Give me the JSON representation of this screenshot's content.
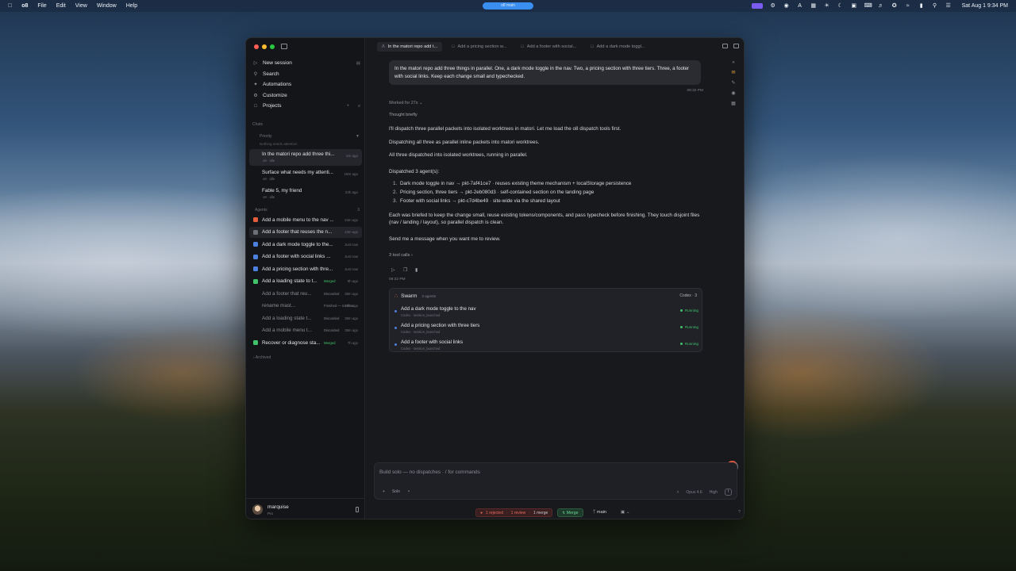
{
  "menubar": {
    "app_name": "o8",
    "menus": [
      "File",
      "Edit",
      "View",
      "Window",
      "Help"
    ],
    "center_pill": "o8 main",
    "clock": "Sat Aug 1  9:34 PM"
  },
  "sidebar": {
    "nav": [
      {
        "label": "New session",
        "icon": "play-icon"
      },
      {
        "label": "Search",
        "icon": "search-icon"
      },
      {
        "label": "Automations",
        "icon": "spark-icon"
      },
      {
        "label": "Customize",
        "icon": "gear-icon"
      },
      {
        "label": "Projects",
        "icon": "folder-icon"
      }
    ],
    "chats_label": "Chats",
    "priority_label": "Priority",
    "priority_sub": "Nothing needs attention",
    "chats": [
      {
        "title": "In the matori repo add three thi...",
        "sub": "o8 · idle",
        "time": "2m ago"
      },
      {
        "title": "Surface what needs my attenti...",
        "sub": "o8 · idle",
        "time": "18m ago"
      },
      {
        "title": "Fable 5, my friend",
        "sub": "o8 · idle",
        "time": "23h ago"
      }
    ],
    "agents_label": "Agents",
    "agents_count": "3",
    "agents": [
      {
        "title": "Add a mobile menu to the nav ...",
        "status": "",
        "time": "24m ago",
        "color": "#e35d3c"
      },
      {
        "title": "Add a footer that reuses the n...",
        "status": "",
        "time": "24m ago",
        "color": "#6d7078"
      },
      {
        "title": "Add a dark mode toggle to the...",
        "status": "",
        "time": "Just now",
        "color": "#4b7fe0"
      },
      {
        "title": "Add a footer with social links ...",
        "status": "",
        "time": "Just now",
        "color": "#4b7fe0"
      },
      {
        "title": "Add a pricing section with thre...",
        "status": "",
        "time": "Just now",
        "color": "#4b7fe0"
      },
      {
        "title": "Add a loading state to t...",
        "status": "Merged",
        "time": "9h ago",
        "color": "#3fc46b"
      },
      {
        "title": "Add a footer that reu...",
        "status": "Discarded",
        "time": "38m ago",
        "color": ""
      },
      {
        "title": "rename mast...",
        "status": "Finished — no char...",
        "time": "38m ago",
        "color": ""
      },
      {
        "title": "Add a loading state t...",
        "status": "Discarded",
        "time": "38m ago",
        "color": ""
      },
      {
        "title": "Add a mobile menu t...",
        "status": "Discarded",
        "time": "38m ago",
        "color": ""
      },
      {
        "title": "Recover or diagnose sta...",
        "status": "Merged",
        "time": "7h ago",
        "color": "#3fc46b"
      }
    ],
    "archived_label": "Archived",
    "user": {
      "name": "marquise",
      "plan": "Pro"
    }
  },
  "tabs": [
    {
      "label": "In the matori repo add t...",
      "active": true
    },
    {
      "label": "Add a pricing section w...",
      "active": false
    },
    {
      "label": "Add a footer with social...",
      "active": false
    },
    {
      "label": "Add a dark mode toggl...",
      "active": false
    }
  ],
  "conversation": {
    "user_message": "In the matori repo add three things in parallel. One, a dark mode toggle in the nav. Two, a pricing section with three tiers. Three, a footer with social links. Keep each change small and typechecked.",
    "user_time": "09:32 PM",
    "worked": "Worked for 27s",
    "thought": "Thought briefly",
    "paragraphs": [
      "I'll dispatch three parallel packets into isolated worktrees in matori. Let me load the o8 dispatch tools first.",
      "Dispatching all three as parallel inline packets into matori worktrees.",
      "All three dispatched into isolated worktrees, running in parallel."
    ],
    "dispatched_heading": "Dispatched 3 agent(s):",
    "agents_list": [
      "Dark mode toggle in nav → pkt-7af41ce7 · reuses existing theme mechanism + localStorage persistence",
      "Pricing section, three tiers → pkt-2eb080d3 · self-contained section on the landing page",
      "Footer with social links → pkt-c7d4be49 · site-wide via the shared layout"
    ],
    "brief": "Each was briefed to keep the change small, reuse existing tokens/components, and pass typecheck before finishing. They touch disjoint files (nav / landing / layout), so parallel dispatch is clean.",
    "closing": "Send me a message when you want me to review.",
    "tool_calls": "3 tool calls",
    "response_time": "09:32 PM"
  },
  "swarm": {
    "title": "Swarm",
    "count": "3 agents",
    "provider": "Codex · 3",
    "rows": [
      {
        "name": "Add a dark mode toggle to the nav",
        "meta": "Codex · session_launched",
        "status": "Running"
      },
      {
        "name": "Add a pricing section with three tiers",
        "meta": "Codex · session_launched",
        "status": "Running"
      },
      {
        "name": "Add a footer with social links",
        "meta": "Codex · session_launched",
        "status": "Running"
      }
    ]
  },
  "composer": {
    "placeholder": "Build solo — no dispatches · / for commands",
    "mode": "Solo",
    "model": "Opus 4.6",
    "effort": "High"
  },
  "statusbar": {
    "rejected": "1 rejected",
    "review": "1 review",
    "merge_count": "1 merge",
    "merge_label": "Merge",
    "branch": "main",
    "help": "?"
  }
}
